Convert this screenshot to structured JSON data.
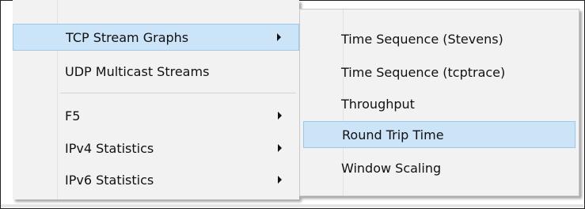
{
  "main_menu": {
    "items": [
      {
        "label": "TCP Stream Graphs",
        "has_submenu": true,
        "highlighted": true
      },
      {
        "label": "UDP Multicast Streams",
        "has_submenu": false,
        "highlighted": false
      },
      {
        "label": "F5",
        "has_submenu": true,
        "highlighted": false
      },
      {
        "label": "IPv4 Statistics",
        "has_submenu": true,
        "highlighted": false
      },
      {
        "label": "IPv6 Statistics",
        "has_submenu": true,
        "highlighted": false
      }
    ]
  },
  "submenu": {
    "items": [
      {
        "label": "Time Sequence (Stevens)",
        "highlighted": false
      },
      {
        "label": "Time Sequence (tcptrace)",
        "highlighted": false
      },
      {
        "label": "Throughput",
        "highlighted": false
      },
      {
        "label": "Round Trip Time",
        "highlighted": true
      },
      {
        "label": "Window Scaling",
        "highlighted": false
      }
    ]
  },
  "colors": {
    "menu_background": "#f2f2f2",
    "highlight_fill": "#cce4f7",
    "highlight_border": "#99c9ef",
    "text": "#111111"
  },
  "icons": {
    "submenu_indicator": "chevron-right-icon"
  }
}
